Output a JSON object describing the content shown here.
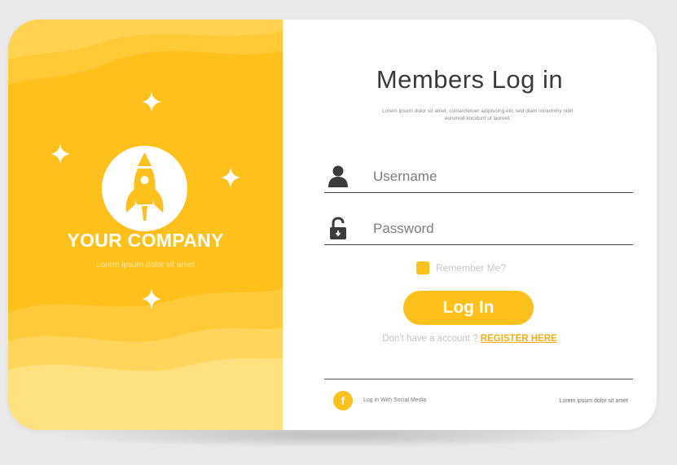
{
  "brand": {
    "company_name": "YOUR COMPANY",
    "tagline": "Lorem ipsum dolor sit amet"
  },
  "login": {
    "title": "Members Log in",
    "subtitle": "Lorem ipsum dolor sit amet, consectetuer adipiscing elit, sed diam nonummy nibh euismod tincidunt ut laoreet.",
    "username": {
      "value": "",
      "placeholder": "Username"
    },
    "password": {
      "value": "",
      "placeholder": "Password"
    },
    "remember_label": "Remember Me?",
    "remember_checked": true,
    "login_button": "Log In",
    "no_account_text": "Don't have a account ?",
    "register_link": "REGISTER HERE"
  },
  "footer": {
    "social_icon_letter": "f",
    "social_label": "Log in With Social Media",
    "right_text": "Lorem ipsum dolor sit amet"
  },
  "icons": {
    "logo": "rocket-icon",
    "username": "user-icon",
    "password": "padlock-icon",
    "social": "facebook-icon",
    "decor": "sparkle-icon"
  },
  "colors": {
    "accent": "#fec01a",
    "link": "#f4ae12",
    "text_dark": "#3a3a3a"
  }
}
